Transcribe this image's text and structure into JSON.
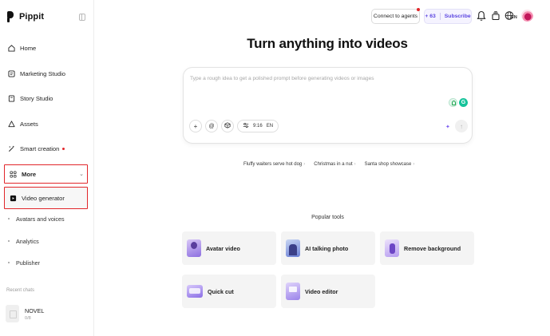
{
  "sidebar": {
    "brand": "Pippit",
    "items": [
      {
        "label": "Home"
      },
      {
        "label": "Marketing Studio"
      },
      {
        "label": "Story Studio"
      },
      {
        "label": "Assets"
      },
      {
        "label": "Smart creation"
      },
      {
        "label": "More"
      }
    ],
    "active_item": "Video generator",
    "sub_items": [
      {
        "label": "Avatars and voices"
      },
      {
        "label": "Analytics"
      },
      {
        "label": "Publisher"
      }
    ],
    "recent_label": "Recent chats",
    "recent_chats": [
      {
        "title": "NOVEL",
        "meta": "0/8"
      }
    ]
  },
  "topbar": {
    "connect_label": "Connect to agents",
    "credits": "+ 63",
    "subscribe_label": "Subscribe",
    "language": "EN"
  },
  "main": {
    "title": "Turn anything into videos",
    "prompt_placeholder": "Type a rough idea to get a polished prompt before generating videos or images",
    "aspect_ratio": "9:16",
    "prompt_language": "EN",
    "suggestions": [
      "Fluffy waiters serve hot dog",
      "Christmas in a nut",
      "Santa shop showcase"
    ],
    "popular_label": "Popular tools",
    "tools": [
      {
        "label": "Avatar video"
      },
      {
        "label": "AI talking photo"
      },
      {
        "label": "Remove background"
      },
      {
        "label": "Quick cut"
      },
      {
        "label": "Video editor"
      }
    ]
  },
  "colors": {
    "highlight_border": "#e1262a",
    "accent": "#5b45e0"
  }
}
